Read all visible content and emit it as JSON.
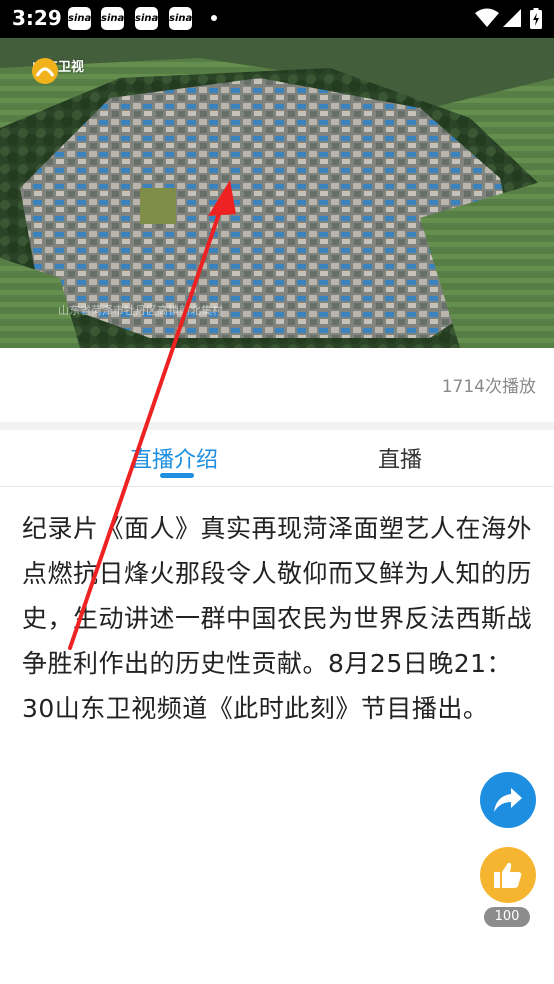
{
  "status_bar": {
    "time": "3:29",
    "notifications": [
      "sina",
      "sina",
      "sina",
      "sina"
    ],
    "icons": [
      "wifi-icon",
      "signal-icon",
      "battery-icon"
    ]
  },
  "video": {
    "channel_name": "山东卫视",
    "caption": "山东省菏泽市牡丹区高镇前北集村"
  },
  "stats": {
    "play_count": "1714次播放"
  },
  "tabs": [
    {
      "label": "直播介绍",
      "active": true
    },
    {
      "label": "直播",
      "active": false
    }
  ],
  "description": "纪录片《面人》真实再现菏泽面塑艺人在海外点燃抗日烽火那段令人敬仰而又鲜为人知的历史，生动讲述一群中国农民为世界反法西斯战争胜利作出的历史性贡献。8月25日晚21：30山东卫视频道《此时此刻》节目播出。",
  "actions": {
    "like_count": "100"
  },
  "colors": {
    "accent": "#1e8fe0",
    "like": "#f5b531",
    "annotation": "#ee2222"
  }
}
